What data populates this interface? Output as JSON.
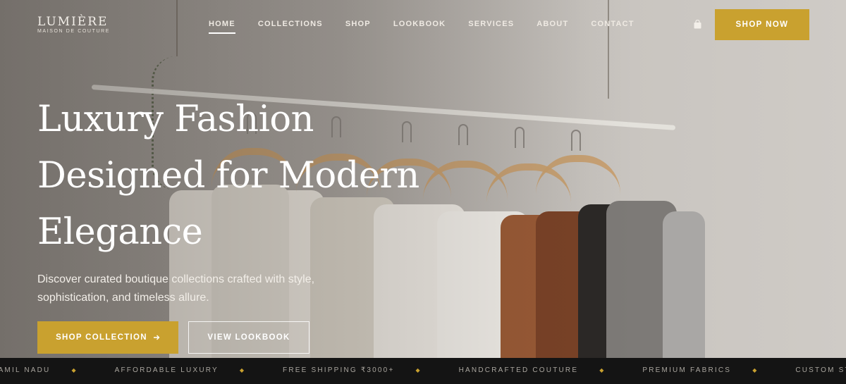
{
  "brand": {
    "name": "LUMIÈRE",
    "tagline": "MAISON DE COUTURE"
  },
  "nav": {
    "items": [
      {
        "label": "HOME",
        "active": true
      },
      {
        "label": "COLLECTIONS",
        "active": false
      },
      {
        "label": "SHOP",
        "active": false
      },
      {
        "label": "LOOKBOOK",
        "active": false
      },
      {
        "label": "SERVICES",
        "active": false
      },
      {
        "label": "ABOUT",
        "active": false
      },
      {
        "label": "CONTACT",
        "active": false
      }
    ],
    "cart_icon": "shopping-bag-icon",
    "cta_label": "SHOP NOW"
  },
  "hero": {
    "headline": "Luxury Fashion Designed for Modern Elegance",
    "subtitle": "Discover curated boutique collections crafted with style, sophistication, and timeless allure.",
    "primary_label": "SHOP COLLECTION",
    "primary_icon": "arrow-right-icon",
    "secondary_label": "VIEW LOOKBOOK"
  },
  "marquee": {
    "items": [
      "TAMIL NADU",
      "AFFORDABLE LUXURY",
      "FREE SHIPPING ₹3000+",
      "HANDCRAFTED COUTURE",
      "PREMIUM FABRICS",
      "CUSTOM STITCHING"
    ],
    "separator": "◆"
  },
  "colors": {
    "accent": "#c9a12f",
    "marquee_bg": "#141414",
    "text_light": "#ffffff"
  }
}
